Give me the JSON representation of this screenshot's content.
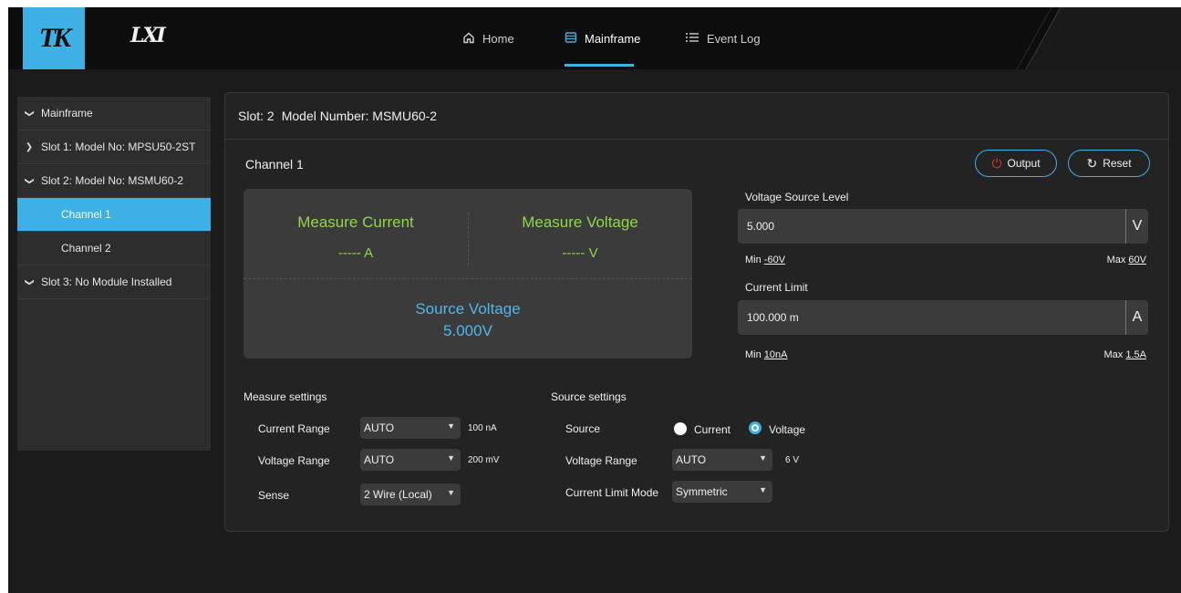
{
  "header": {
    "brand": "TK",
    "lxi": "LXI",
    "nav": [
      {
        "label": "Home",
        "icon": "home-icon"
      },
      {
        "label": "Mainframe",
        "icon": "panel-icon"
      },
      {
        "label": "Event Log",
        "icon": "list-icon"
      }
    ],
    "active_nav": "Mainframe"
  },
  "sidebar": {
    "items": [
      {
        "label": "Mainframe"
      },
      {
        "label": "Slot 1: Model No: MPSU50-2ST"
      },
      {
        "label": "Slot 2: Model No: MSMU60-2"
      },
      {
        "label": "Channel 1",
        "active": true
      },
      {
        "label": "Channel 2"
      },
      {
        "label": "Slot 3: No Module Installed"
      }
    ]
  },
  "panel": {
    "slot_label": "Slot: 2",
    "model_label": "Model Number: MSMU60-2",
    "channel_title": "Channel 1",
    "output_label": "Output",
    "reset_label": "Reset"
  },
  "measure": {
    "current_label": "Measure Current",
    "current_value": "----- A",
    "voltage_label": "Measure Voltage",
    "voltage_value": "----- V",
    "source_label": "Source Voltage",
    "source_value": "5.000V"
  },
  "voltage_source": {
    "label": "Voltage Source Level",
    "value": "5.000",
    "unit": "V",
    "min_prefix": "Min",
    "min": "-60V",
    "max_prefix": "Max",
    "max": "60V"
  },
  "current_limit": {
    "label": "Current Limit",
    "value": "100.000 m",
    "unit": "A",
    "min_prefix": "Min",
    "min": "10nA",
    "max_prefix": "Max",
    "max": "1.5A"
  },
  "measure_settings": {
    "title": "Measure settings",
    "current_range_label": "Current Range",
    "current_range_value": "AUTO",
    "current_range_hint": "100 nA",
    "voltage_range_label": "Voltage Range",
    "voltage_range_value": "AUTO",
    "voltage_range_hint": "200 mV",
    "sense_label": "Sense",
    "sense_value": "2 Wire (Local)"
  },
  "source_settings": {
    "title": "Source settings",
    "source_label": "Source",
    "opt_current": "Current",
    "opt_voltage": "Voltage",
    "selected": "Voltage",
    "voltage_range_label": "Voltage Range",
    "voltage_range_value": "AUTO",
    "voltage_range_hint": "6 V",
    "limit_mode_label": "Current Limit Mode",
    "limit_mode_value": "Symmetric"
  },
  "colors": {
    "accent": "#3db0e6",
    "measure_green": "#8fd64a",
    "source_blue": "#4fb6ef",
    "power_red": "#e0352b"
  }
}
